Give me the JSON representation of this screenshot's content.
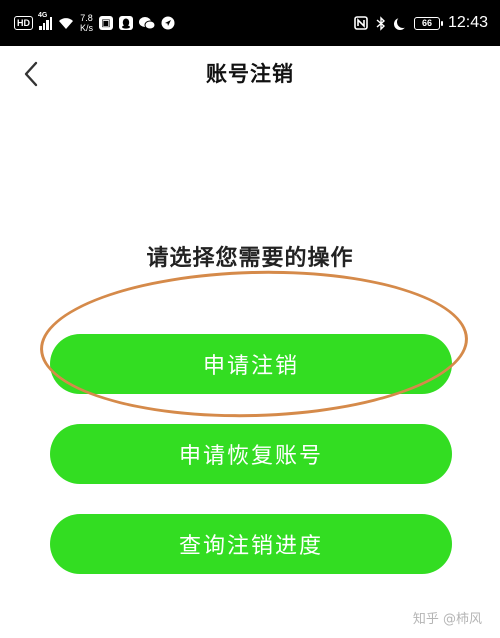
{
  "status_bar": {
    "hd_badge": "HD",
    "network": "4G",
    "net_speed_value": "7.8",
    "net_speed_unit": "K/s",
    "battery": "66",
    "time": "12:43",
    "icons": [
      "hd-icon",
      "signal-icon",
      "wifi-icon",
      "app-notification-icon",
      "qq-icon",
      "wechat-icon",
      "location-icon",
      "nfc-icon",
      "bluetooth-icon",
      "moon-icon",
      "battery-icon"
    ]
  },
  "nav": {
    "title": "账号注销",
    "back_icon": "chevron-left-icon"
  },
  "prompt": "请选择您需要的操作",
  "buttons": {
    "apply_cancel": "申请注销",
    "restore_account": "申请恢复账号",
    "query_progress": "查询注销进度"
  },
  "colors": {
    "button": "#33dd22",
    "annotation": "#d58a4a",
    "status_bar": "#000000"
  },
  "watermark": "知乎 @柿风"
}
